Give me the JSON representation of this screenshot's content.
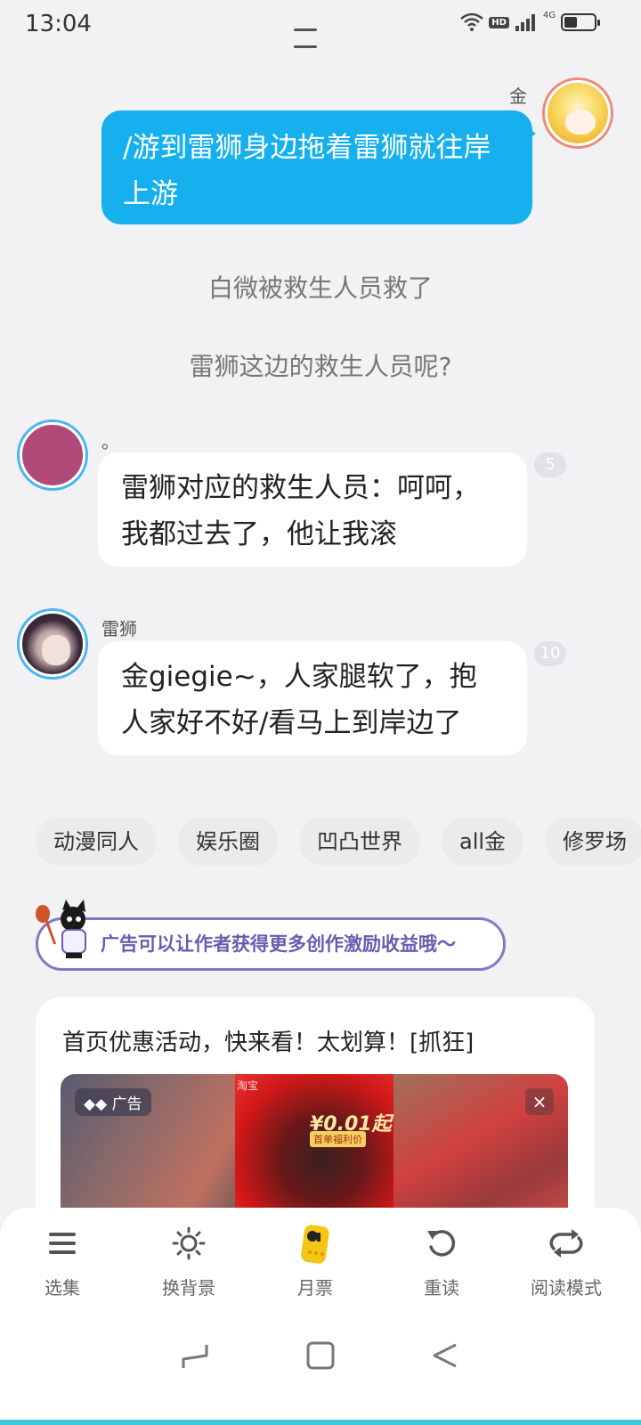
{
  "status": {
    "time": "13:04",
    "hd": "HD",
    "network": "4G"
  },
  "chat": {
    "me": {
      "name": "金",
      "message": "/游到雷狮身边拖着雷狮就往岸上游"
    },
    "narrations": [
      "白微被救生人员救了",
      "雷狮这边的救生人员呢?"
    ],
    "incoming": [
      {
        "name": "。",
        "message": "雷狮对应的救生人员：呵呵，我都过去了，他让我滚",
        "count": "5"
      },
      {
        "name": "雷狮",
        "message": "金giegie~，人家腿软了，抱人家好不好/看马上到岸边了",
        "count": "10"
      }
    ]
  },
  "tags": [
    "动漫同人",
    "娱乐圈",
    "凹凸世界",
    "all金",
    "修罗场"
  ],
  "ad": {
    "hint": "广告可以让作者获得更多创作激励收益哦～",
    "title": "首页优惠活动，快来看！太划算！[抓狂]",
    "label": "广告",
    "taobao": "淘宝",
    "price": "¥0.01起",
    "price_sub": "首单福利价",
    "close": "×"
  },
  "toolbar": {
    "items": [
      {
        "label": "选集",
        "icon": "menu-icon"
      },
      {
        "label": "换背景",
        "icon": "sun-icon"
      },
      {
        "label": "月票",
        "icon": "ticket-icon"
      },
      {
        "label": "重读",
        "icon": "reload-icon"
      },
      {
        "label": "阅读模式",
        "icon": "loop-icon"
      }
    ]
  },
  "colors": {
    "accent": "#16b0ef",
    "avatar_ring": "#4ab4f0",
    "ad_border": "#8677c6"
  }
}
